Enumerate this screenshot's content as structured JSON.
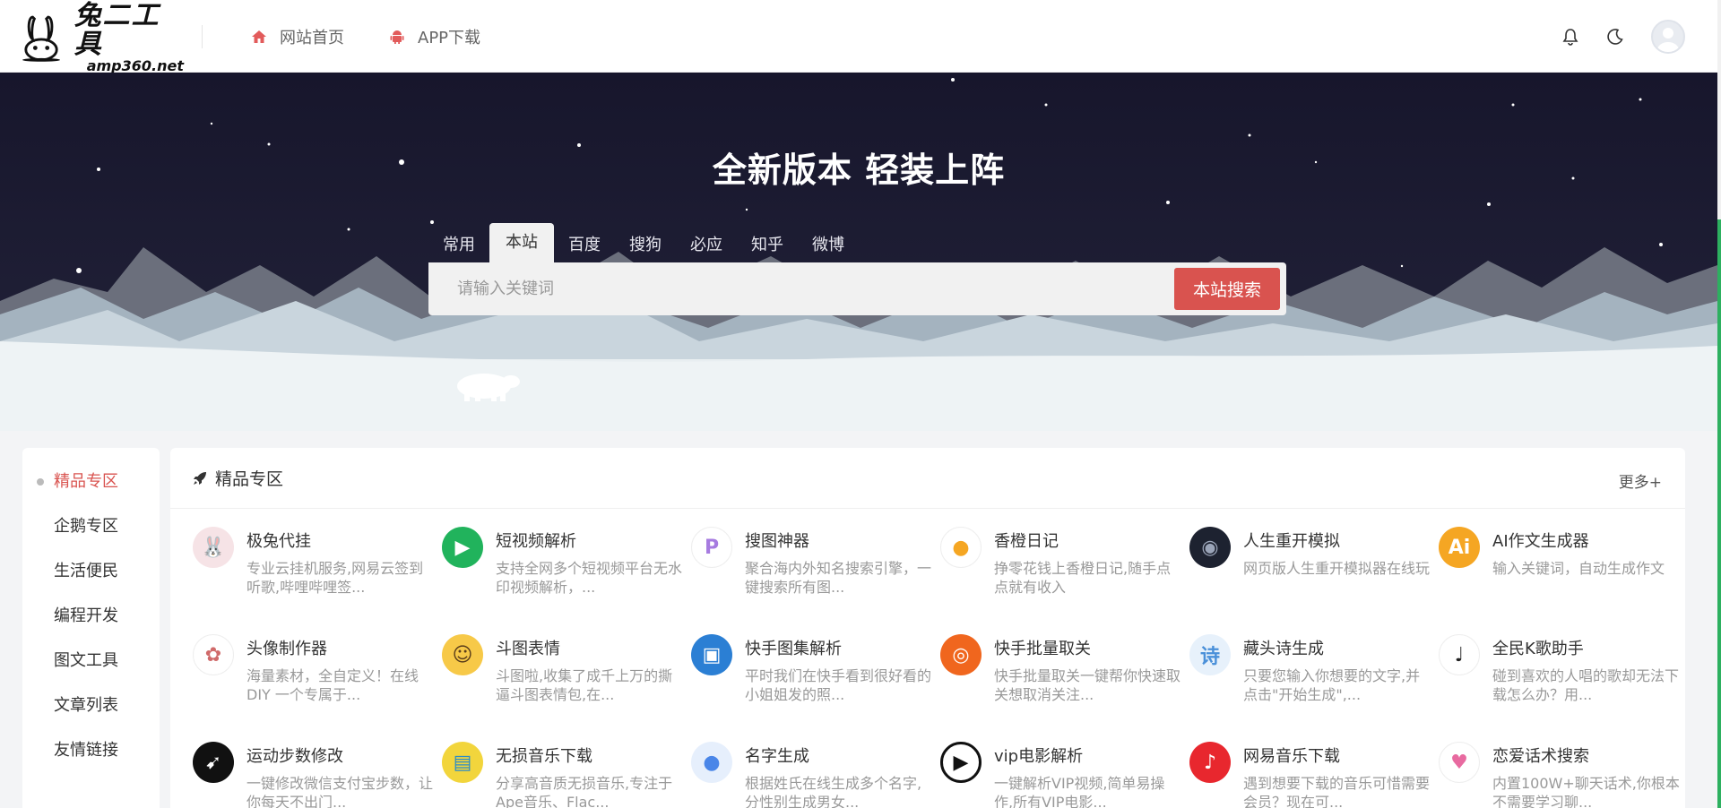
{
  "header": {
    "logo_main": "兔二工具",
    "logo_sub": "amp360.net",
    "nav": [
      {
        "label": "网站首页",
        "icon": "home-icon"
      },
      {
        "label": "APP下载",
        "icon": "android-icon"
      }
    ],
    "icons": [
      "bell-icon",
      "moon-icon",
      "avatar"
    ]
  },
  "hero": {
    "title": "全新版本 轻装上阵",
    "tabs": [
      "常用",
      "本站",
      "百度",
      "搜狗",
      "必应",
      "知乎",
      "微博"
    ],
    "active_tab": "本站",
    "search_placeholder": "请输入关键词",
    "search_button": "本站搜索"
  },
  "sidebar": {
    "items": [
      {
        "label": "精品专区",
        "active": true
      },
      {
        "label": "企鹅专区"
      },
      {
        "label": "生活便民"
      },
      {
        "label": "编程开发"
      },
      {
        "label": "图文工具"
      },
      {
        "label": "文章列表"
      },
      {
        "label": "友情链接"
      }
    ]
  },
  "panel": {
    "title": "精品专区",
    "more": "更多+",
    "cards": [
      {
        "title": "极兔代挂",
        "desc": "专业云挂机服务,网易云签到听歌,哔哩哔哩签...",
        "icon": "rabbit-icon",
        "color": "#f6e3e6"
      },
      {
        "title": "短视频解析",
        "desc": "支持全网多个短视频平台无水印视频解析，...",
        "icon": "tv-icon",
        "color": "#21b35c"
      },
      {
        "title": "搜图神器",
        "desc": "聚合海内外知名搜索引擎，一键搜索所有图...",
        "icon": "p-letter-icon",
        "color": "#ffffff"
      },
      {
        "title": "香橙日记",
        "desc": "挣零花钱上香橙日记,随手点点就有收入",
        "icon": "orange-icon",
        "color": "#ffffff"
      },
      {
        "title": "人生重开模拟",
        "desc": "网页版人生重开模拟器在线玩",
        "icon": "life-sim-icon",
        "color": "#1d2230"
      },
      {
        "title": "AI作文生成器",
        "desc": "输入关键词，自动生成作文",
        "icon": "ai-icon",
        "color": "#f5a623"
      },
      {
        "title": "头像制作器",
        "desc": "海量素材，全自定义！在线 DIY 一个专属于...",
        "icon": "avatar-maker-icon",
        "color": "#ffffff"
      },
      {
        "title": "斗图表情",
        "desc": "斗图啦,收集了成千上万的撕逼斗图表情包,在...",
        "icon": "meme-icon",
        "color": "#f7c948"
      },
      {
        "title": "快手图集解析",
        "desc": "平时我们在快手看到很好看的小姐姐发的照...",
        "icon": "image-icon",
        "color": "#2b7fd4"
      },
      {
        "title": "快手批量取关",
        "desc": "快手批量取关一键帮你快速取关想取消关注...",
        "icon": "kuaishou-icon",
        "color": "#f0661e"
      },
      {
        "title": "藏头诗生成",
        "desc": "只要您输入你想要的文字,并点击\"开始生成\",...",
        "icon": "poem-icon",
        "color": "#e7f1fb"
      },
      {
        "title": "全民K歌助手",
        "desc": "碰到喜欢的人唱的歌却无法下载怎么办？用...",
        "icon": "microphone-icon",
        "color": "#ffffff"
      },
      {
        "title": "运动步数修改",
        "desc": "一键修改微信支付宝步数，让你每天不出门...",
        "icon": "running-icon",
        "color": "#111111"
      },
      {
        "title": "无损音乐下载",
        "desc": "分享高音质无损音乐,专注于Ape音乐、Flac...",
        "icon": "cassette-icon",
        "color": "#f2d53c"
      },
      {
        "title": "名字生成",
        "desc": "根据姓氏在线生成多个名字,分性别生成男女...",
        "icon": "person-icon",
        "color": "#e6effc"
      },
      {
        "title": "vip电影解析",
        "desc": "一键解析VIP视频,简单易操作,所有VIP电影...",
        "icon": "play-icon",
        "color": "#ffffff"
      },
      {
        "title": "网易音乐下载",
        "desc": "遇到想要下载的音乐可惜需要会员？现在可...",
        "icon": "netease-music-icon",
        "color": "#e8272e"
      },
      {
        "title": "恋爱话术搜索",
        "desc": "内置100W+聊天话术,你根本不需要学习聊...",
        "icon": "heart-icon",
        "color": "#ffffff"
      }
    ]
  }
}
